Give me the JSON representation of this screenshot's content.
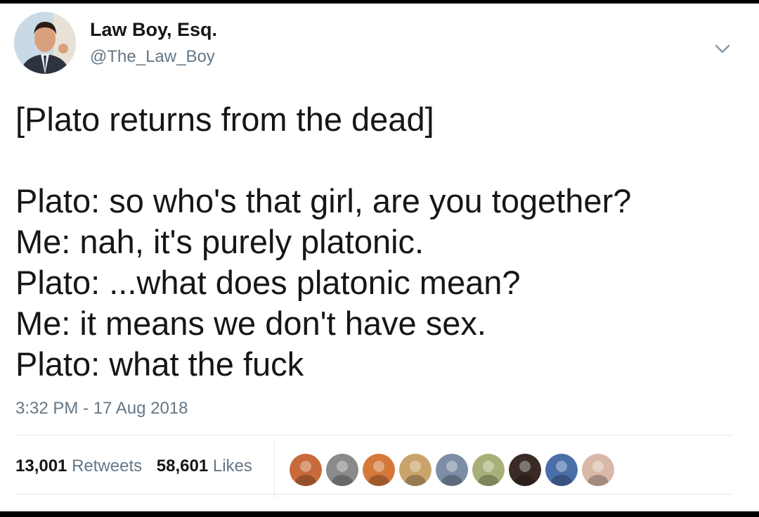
{
  "tweet": {
    "author": {
      "display_name": "Law Boy, Esq.",
      "handle": "@The_Law_Boy",
      "avatar_icon": "person-avatar-icon"
    },
    "menu_icon": "chevron-down-icon",
    "text_lines": [
      "[Plato returns from the dead]",
      "",
      "Plato: so who's that girl, are you together?",
      "Me: nah, it's purely platonic.",
      "Plato: ...what does platonic mean?",
      "Me: it means we don't have sex.",
      "Plato: what the fuck"
    ],
    "timestamp": "3:32 PM - 17 Aug 2018",
    "stats": {
      "retweets_count": "13,001",
      "retweets_label": "Retweets",
      "likes_count": "58,601",
      "likes_label": "Likes"
    },
    "likers": [
      {
        "icon": "liker-avatar-icon",
        "color": "#c86a3a"
      },
      {
        "icon": "liker-avatar-icon",
        "color": "#8a8a8a"
      },
      {
        "icon": "liker-avatar-icon",
        "color": "#d4793a"
      },
      {
        "icon": "liker-avatar-icon",
        "color": "#c9a36b"
      },
      {
        "icon": "liker-avatar-icon",
        "color": "#7c8ea6"
      },
      {
        "icon": "liker-avatar-icon",
        "color": "#a8b07a"
      },
      {
        "icon": "liker-avatar-icon",
        "color": "#3a2a24"
      },
      {
        "icon": "liker-avatar-icon",
        "color": "#4a6fa8"
      },
      {
        "icon": "liker-avatar-icon",
        "color": "#d9b8a8"
      }
    ]
  },
  "colors": {
    "text_primary": "#14171a",
    "text_secondary": "#657786",
    "divider": "#e1e8ed",
    "frame": "#000000"
  }
}
